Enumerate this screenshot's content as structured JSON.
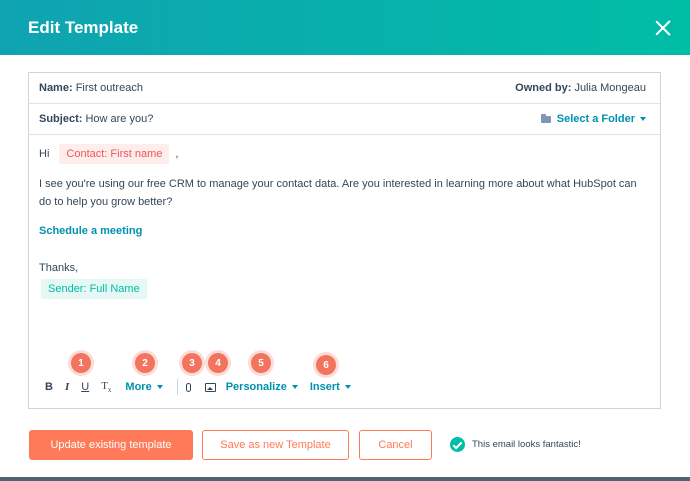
{
  "header": {
    "title": "Edit Template"
  },
  "template": {
    "name_label": "Name:",
    "name_value": "First outreach",
    "owner_label": "Owned by:",
    "owner_value": "Julia Mongeau",
    "subject_label": "Subject:",
    "subject_value": "How are you?",
    "folder_label": "Select a Folder"
  },
  "body": {
    "greeting": "Hi",
    "contact_token": "Contact: First name",
    "greeting_comma": ",",
    "paragraph": "I see you're using our free CRM to manage your contact data. Are you interested in learning more about what HubSpot can do to help you grow better?",
    "meeting_link": "Schedule a meeting",
    "signoff": "Thanks,",
    "sender_token": "Sender: Full Name"
  },
  "toolbar": {
    "bold": "B",
    "italic": "I",
    "underline": "U",
    "clear_format": "T",
    "clear_format_sub": "x",
    "more": "More",
    "personalize": "Personalize",
    "insert": "Insert"
  },
  "badges": [
    "1",
    "2",
    "3",
    "4",
    "5",
    "6"
  ],
  "footer": {
    "update_button": "Update existing template",
    "save_new_button": "Save as new Template",
    "cancel_button": "Cancel",
    "status_text": "This email looks fantastic!"
  },
  "colors": {
    "header_start": "#0fa3b1",
    "header_end": "#00bda5",
    "accent_orange": "#ff7a59",
    "link_teal": "#0091ae",
    "badge": "#f2745f",
    "success": "#00bda5"
  }
}
